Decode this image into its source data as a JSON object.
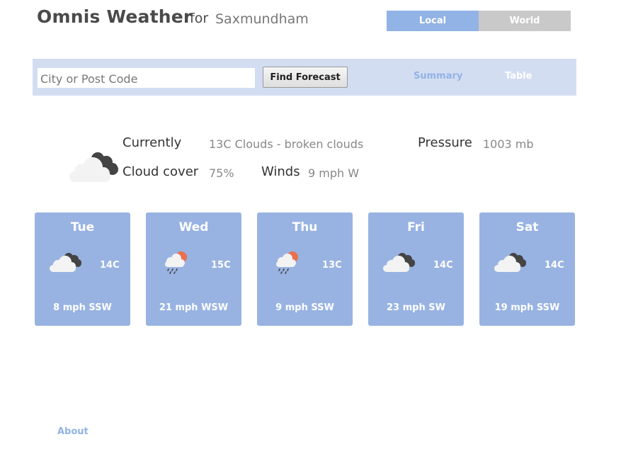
{
  "header": {
    "title": "Omnis Weather",
    "for": "for",
    "location": "Saxmundham",
    "tabs": {
      "local": "Local",
      "world": "World"
    }
  },
  "search": {
    "placeholder": "City or Post Code",
    "value": "",
    "button": "Find Forecast",
    "views": {
      "summary": "Summary",
      "table": "Table"
    }
  },
  "current": {
    "icon": "cloud-broken-icon",
    "currently_label": "Currently",
    "currently_value": "13C Clouds - broken clouds",
    "pressure_label": "Pressure",
    "pressure_value": "1003 mb",
    "cloud_label": "Cloud cover",
    "cloud_value": "75%",
    "winds_label": "Winds",
    "winds_value": "9 mph W"
  },
  "forecast": [
    {
      "day": "Tue",
      "temp": "14C",
      "wind": "8 mph SSW",
      "icon": "cloud-broken-icon"
    },
    {
      "day": "Wed",
      "temp": "15C",
      "wind": "21 mph WSW",
      "icon": "rain-sun-icon"
    },
    {
      "day": "Thu",
      "temp": "13C",
      "wind": "9 mph SSW",
      "icon": "rain-sun-icon"
    },
    {
      "day": "Fri",
      "temp": "14C",
      "wind": "23 mph SW",
      "icon": "cloud-broken-icon"
    },
    {
      "day": "Sat",
      "temp": "14C",
      "wind": "19 mph SSW",
      "icon": "cloud-broken-icon"
    }
  ],
  "footer": {
    "about": "About"
  },
  "colors": {
    "accent": "#91b3e6",
    "card": "#98b3e2",
    "band": "#d3ddf2",
    "tab_inactive": "#c9c9c9",
    "sun": "#e9714d"
  }
}
